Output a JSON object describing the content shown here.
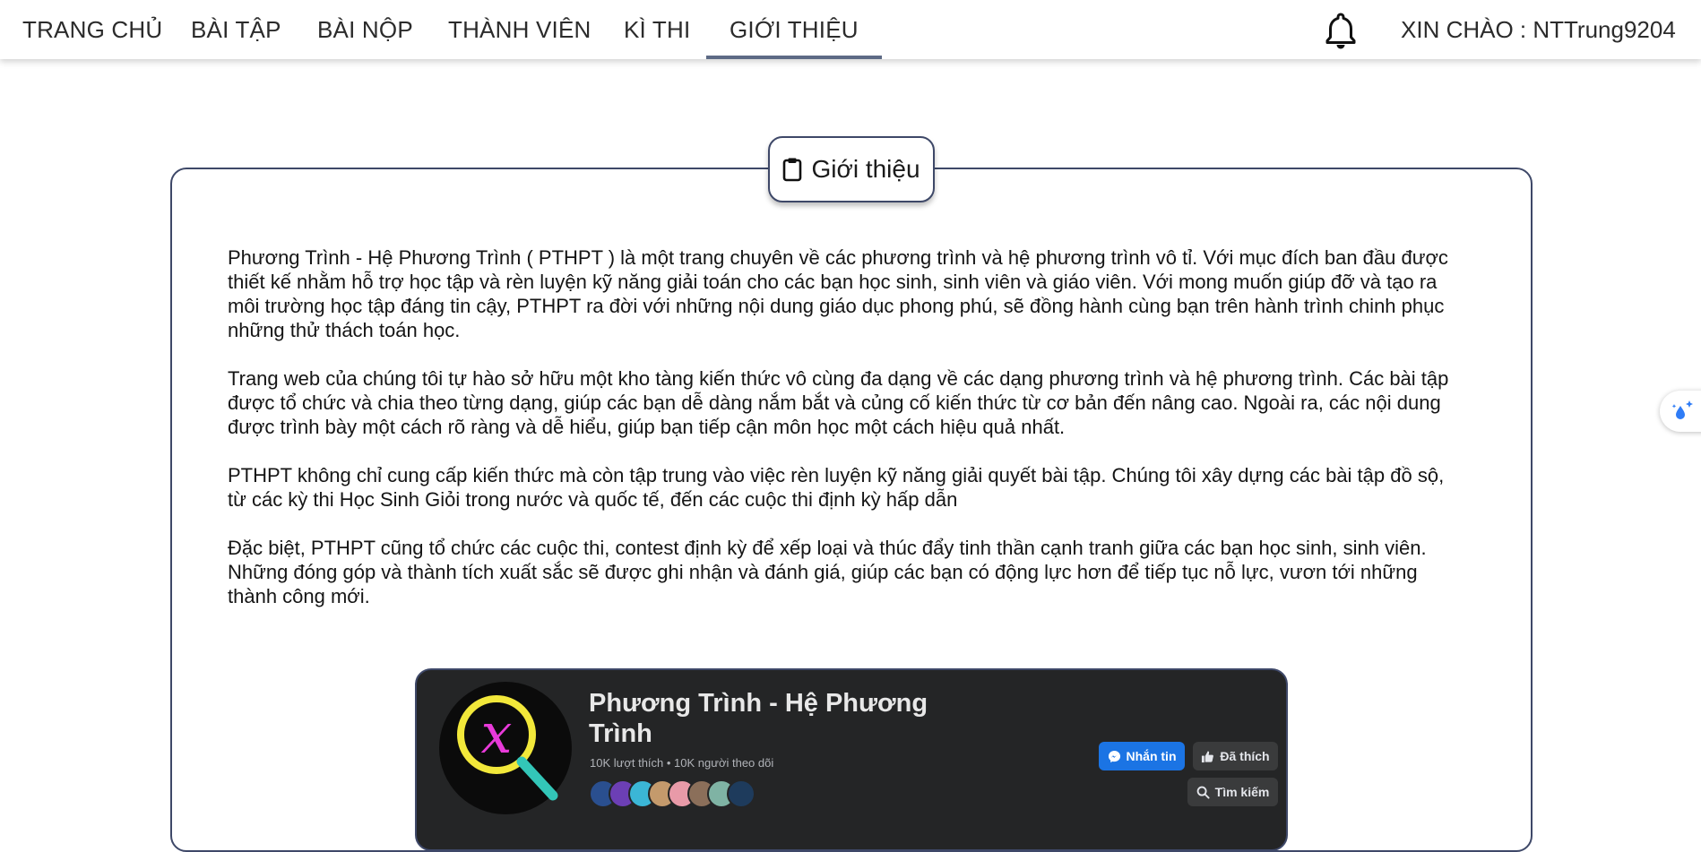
{
  "nav": {
    "items": [
      {
        "label": "TRANG CHỦ"
      },
      {
        "label": "BÀI TẬP"
      },
      {
        "label": "BÀI NỘP"
      },
      {
        "label": "THÀNH VIÊN"
      },
      {
        "label": "KÌ THI"
      },
      {
        "label": "GIỚI THIỆU"
      }
    ],
    "active": "GIỚI THIỆU",
    "greeting": "XIN CHÀO : NTTrung9204",
    "bell_icon": "bell-icon"
  },
  "section": {
    "title": "Giới thiệu",
    "icon": "clipboard-icon",
    "paragraphs": [
      "Phương Trình - Hệ Phương Trình ( PTHPT ) là một trang chuyên về các phương trình và hệ phương trình vô tỉ. Với mục đích ban đầu được thiết kế nhằm hỗ trợ học tập và rèn luyện kỹ năng giải toán cho các bạn học sinh, sinh viên và giáo viên. Với mong muốn giúp đỡ và tạo ra môi trường học tập đáng tin cậy, PTHPT ra đời với những nội dung giáo dục phong phú, sẽ đồng hành cùng bạn trên hành trình chinh phục những thử thách toán học.",
      "Trang web của chúng tôi tự hào sở hữu một kho tàng kiến thức vô cùng đa dạng về các dạng phương trình và hệ phương trình. Các bài tập được tổ chức và chia theo từng dạng, giúp các bạn dễ dàng nắm bắt và củng cố kiến thức từ cơ bản đến nâng cao. Ngoài ra, các nội dung được trình bày một cách rõ ràng và dễ hiểu, giúp bạn tiếp cận môn học một cách hiệu quả nhất.",
      "PTHPT không chỉ cung cấp kiến thức mà còn tập trung vào việc rèn luyện kỹ năng giải quyết bài tập. Chúng tôi xây dựng các bài tập đồ sộ, từ các kỳ thi Học Sinh Giỏi trong nước và quốc tế, đến các cuộc thi định kỳ hấp dẫn",
      "Đặc biệt, PTHPT cũng tổ chức các cuộc thi, contest định kỳ để xếp loại và thúc đẩy tinh thần cạnh tranh giữa các bạn học sinh, sinh viên. Những đóng góp và thành tích xuất sắc sẽ được ghi nhận và đánh giá, giúp các bạn có động lực hơn để tiếp tục nỗ lực, vươn tới những thành công mới."
    ]
  },
  "facebook": {
    "page_name": "Phương Trình - Hệ Phương Trình",
    "stats": "10K lượt thích • 10K người theo dõi",
    "logo_letter": "x",
    "message_button": "Nhắn tin",
    "liked_button": "Đã thích",
    "search_button": "Tìm kiếm",
    "friend_colors": [
      "#2a4f8f",
      "#6c3fb5",
      "#3bb6d6",
      "#c49a6c",
      "#e89aa8",
      "#8b6f5a",
      "#7fb3a4",
      "#1e3b5c"
    ]
  },
  "colors": {
    "border": "#3e4868",
    "nav_underline": "#5d6a85",
    "fb_background": "#242526",
    "fb_primary": "#1b74e4"
  }
}
